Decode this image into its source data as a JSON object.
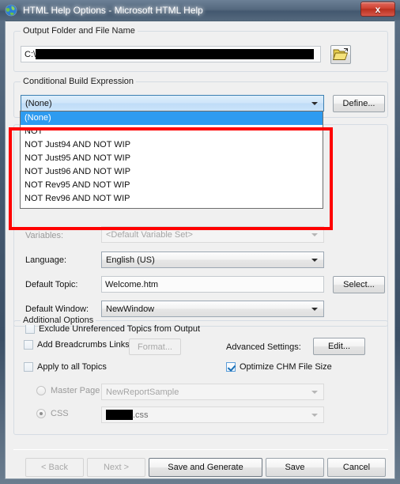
{
  "window": {
    "title": "HTML Help Options - Microsoft HTML Help",
    "icon": "globe-icon",
    "close_label": "x"
  },
  "output_group": {
    "legend": "Output Folder and File Name",
    "path_prefix": "C:\\",
    "path_redacted": true,
    "browse_icon": "open-folder-icon"
  },
  "conditional_group": {
    "legend": "Conditional Build Expression",
    "combo_value": "(None)",
    "define_label": "Define...",
    "dropdown_options": [
      "(None)",
      "NOT",
      "NOT Just94 AND NOT WIP",
      "NOT Just95 AND NOT WIP",
      "NOT Just96 AND NOT WIP",
      "NOT Rev95 AND NOT WIP",
      "NOT Rev96 AND NOT WIP"
    ],
    "dropdown_selected_index": 0
  },
  "settings": {
    "variables_label": "Variables:",
    "variables_value": "<Default Variable Set>",
    "language_label": "Language:",
    "language_value": "English (US)",
    "default_topic_label": "Default Topic:",
    "default_topic_value": "Welcome.htm",
    "select_label": "Select...",
    "default_window_label": "Default Window:",
    "default_window_value": "NewWindow",
    "exclude_label": "Exclude Unreferenced Topics from Output",
    "exclude_checked": false
  },
  "additional": {
    "legend": "Additional Options",
    "breadcrumbs_label": "Add Breadcrumbs Links",
    "breadcrumbs_checked": false,
    "format_label": "Format...",
    "apply_all_label": "Apply to all Topics",
    "apply_all_checked": false,
    "advanced_label": "Advanced Settings:",
    "edit_label": "Edit...",
    "optimize_label": "Optimize CHM File Size",
    "optimize_checked": true,
    "master_page_label": "Master Page",
    "master_page_value": "NewReportSample",
    "master_page_selected": false,
    "css_label": "CSS",
    "css_suffix": ".css",
    "css_redacted": true,
    "css_selected": true
  },
  "footer": {
    "back_label": "< Back",
    "next_label": "Next >",
    "save_generate_label": "Save and Generate",
    "save_label": "Save",
    "cancel_label": "Cancel"
  },
  "annotation": {
    "color": "#ff0000",
    "shape": "rectangle-highlight"
  }
}
